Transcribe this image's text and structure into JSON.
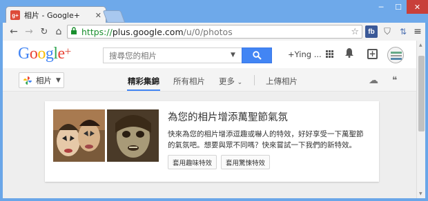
{
  "browser": {
    "tab_title": "相片 - Google+",
    "tab_favicon_text": "g+",
    "url_protocol": "https://",
    "url_host": "plus.google.com",
    "url_path": "/u/0/photos",
    "ext_fb_label": "fb",
    "icons": [
      "back-icon",
      "forward-icon",
      "reload-icon",
      "home-icon",
      "lock-icon",
      "star-icon",
      "facebook-icon",
      "shield-icon",
      "translate-icon",
      "menu-icon"
    ]
  },
  "gbar": {
    "logo": {
      "G": "G",
      "o1": "o",
      "o2": "o",
      "g": "g",
      "l": "l",
      "e": "e",
      "plus": "+"
    },
    "search_placeholder": "搜尋您的相片",
    "user_name": "+Ying ..."
  },
  "subnav": {
    "app_label": "相片",
    "tabs": [
      {
        "label": "精彩集錦",
        "active": true
      },
      {
        "label": "所有相片",
        "active": false
      },
      {
        "label": "更多",
        "active": false
      },
      {
        "label": "上傳相片",
        "active": false
      }
    ]
  },
  "card": {
    "title": "為您的相片增添萬聖節氣氛",
    "text": "快來為您的相片增添逗趣或嚇人的特效，好好享受一下萬聖節的氣氛吧。想要與眾不同嗎？快來嘗試一下我們的新特效。",
    "btn_fun": "套用趣味特效",
    "btn_scary": "套用驚悚特效"
  },
  "colors": {
    "accent": "#4285f4",
    "window_frame": "#6ea9ea",
    "close": "#c8403a",
    "url_green": "#1a8f2e"
  }
}
